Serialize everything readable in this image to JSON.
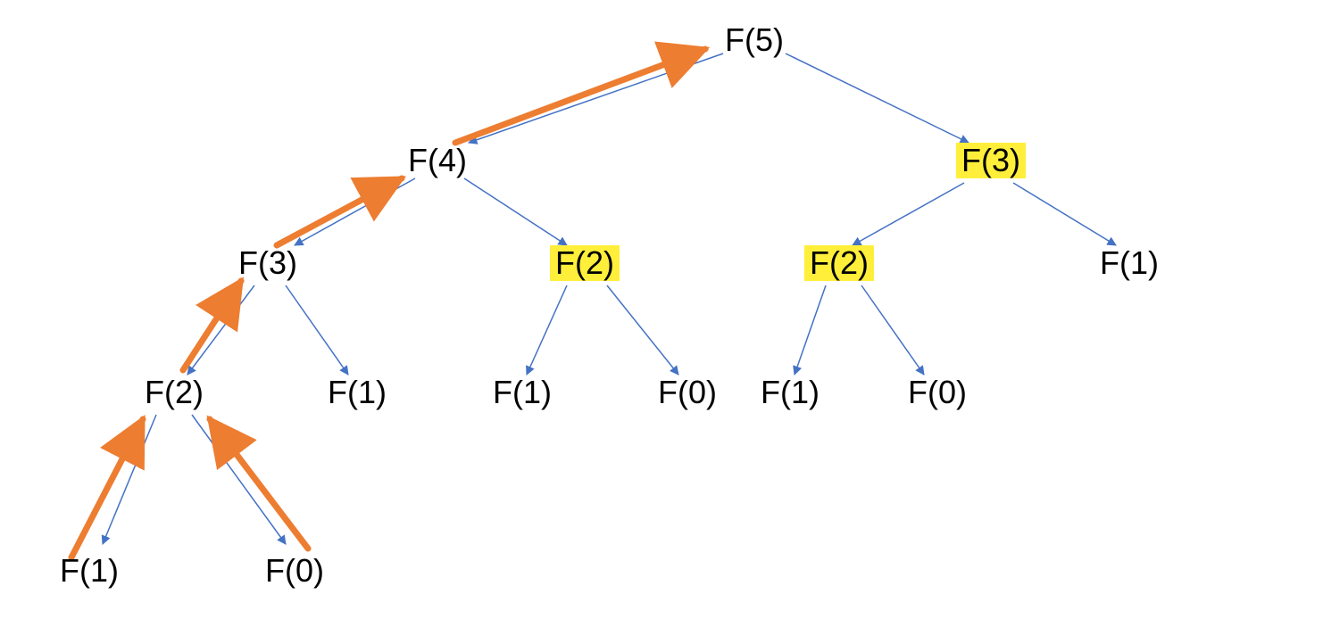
{
  "diagram": {
    "type": "recursion-tree",
    "description": "Fibonacci recursion tree for F(5) with memoization opportunities highlighted and bottom-up evaluation path arrows",
    "nodes": {
      "f5": {
        "label": "F(5)",
        "highlighted": false
      },
      "f4": {
        "label": "F(4)",
        "highlighted": false
      },
      "f3_r": {
        "label": "F(3)",
        "highlighted": true
      },
      "f3_l": {
        "label": "F(3)",
        "highlighted": false
      },
      "f2_m": {
        "label": "F(2)",
        "highlighted": true
      },
      "f2_r": {
        "label": "F(2)",
        "highlighted": true
      },
      "f1_rr": {
        "label": "F(1)",
        "highlighted": false
      },
      "f2_ll": {
        "label": "F(2)",
        "highlighted": false
      },
      "f1_l": {
        "label": "F(1)",
        "highlighted": false
      },
      "f1_m1": {
        "label": "F(1)",
        "highlighted": false
      },
      "f0_m": {
        "label": "F(0)",
        "highlighted": false
      },
      "f1_r1": {
        "label": "F(1)",
        "highlighted": false
      },
      "f0_r": {
        "label": "F(0)",
        "highlighted": false
      },
      "f1_bl": {
        "label": "F(1)",
        "highlighted": false
      },
      "f0_bl": {
        "label": "F(0)",
        "highlighted": false
      }
    },
    "edges_down": [
      [
        "f5",
        "f4"
      ],
      [
        "f5",
        "f3_r"
      ],
      [
        "f4",
        "f3_l"
      ],
      [
        "f4",
        "f2_m"
      ],
      [
        "f3_r",
        "f2_r"
      ],
      [
        "f3_r",
        "f1_rr"
      ],
      [
        "f3_l",
        "f2_ll"
      ],
      [
        "f3_l",
        "f1_l"
      ],
      [
        "f2_m",
        "f1_m1"
      ],
      [
        "f2_m",
        "f0_m"
      ],
      [
        "f2_r",
        "f1_r1"
      ],
      [
        "f2_r",
        "f0_r"
      ],
      [
        "f2_ll",
        "f1_bl"
      ],
      [
        "f2_ll",
        "f0_bl"
      ]
    ],
    "edges_up_orange": [
      [
        "f1_bl",
        "f2_ll"
      ],
      [
        "f0_bl",
        "f2_ll"
      ],
      [
        "f2_ll",
        "f3_l"
      ],
      [
        "f3_l",
        "f4"
      ],
      [
        "f4",
        "f5"
      ]
    ],
    "colors": {
      "edge_blue": "#4472C4",
      "edge_orange": "#ED7D31",
      "highlight_bg": "#ffef3a"
    }
  }
}
